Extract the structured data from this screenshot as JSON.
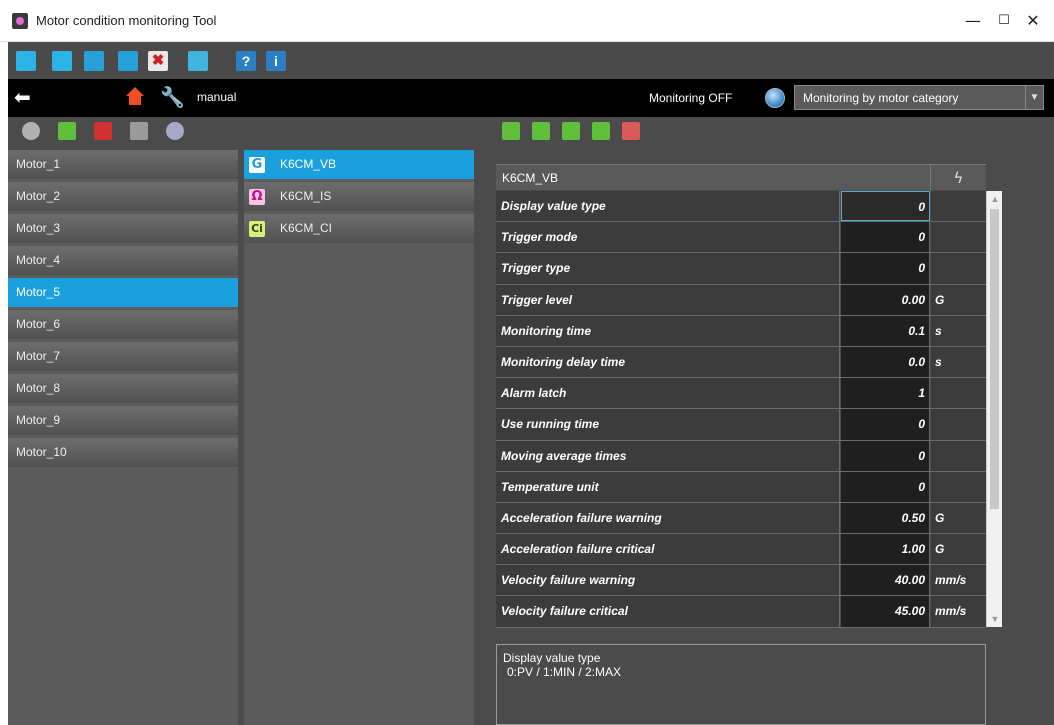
{
  "window": {
    "title": "Motor condition monitoring Tool",
    "minimize": "—",
    "maximize": "☐",
    "close": "✕"
  },
  "nav": {
    "mode_label": "manual",
    "monitoring_status": "Monitoring OFF",
    "monitoring_select": "Monitoring by motor category"
  },
  "motors": [
    {
      "label": "Motor_1"
    },
    {
      "label": "Motor_2"
    },
    {
      "label": "Motor_3"
    },
    {
      "label": "Motor_4"
    },
    {
      "label": "Motor_5",
      "selected": true
    },
    {
      "label": "Motor_6"
    },
    {
      "label": "Motor_7"
    },
    {
      "label": "Motor_8"
    },
    {
      "label": "Motor_9"
    },
    {
      "label": "Motor_10"
    }
  ],
  "sensors": [
    {
      "label": "K6CM_VB",
      "badge": "G",
      "badge_color": "#1aa0dd",
      "badge_bg": "#ffffff",
      "selected": true
    },
    {
      "label": "K6CM_IS",
      "badge": "Ω",
      "badge_color": "#c0128a",
      "badge_bg": "#f2c7e5"
    },
    {
      "label": "K6CM_CI",
      "badge": "Ci",
      "badge_color": "#2a4a10",
      "badge_bg": "#d7ef7a"
    }
  ],
  "param_table": {
    "header": "K6CM_VB",
    "header_icon": "lightning-icon",
    "rows": [
      {
        "label": "Display value type",
        "value": "0",
        "unit": ""
      },
      {
        "label": "Trigger mode",
        "value": "0",
        "unit": ""
      },
      {
        "label": "Trigger type",
        "value": "0",
        "unit": ""
      },
      {
        "label": "Trigger level",
        "value": "0.00",
        "unit": "G"
      },
      {
        "label": "Monitoring time",
        "value": "0.1",
        "unit": "s"
      },
      {
        "label": "Monitoring delay time",
        "value": "0.0",
        "unit": "s"
      },
      {
        "label": "Alarm latch",
        "value": "1",
        "unit": ""
      },
      {
        "label": "Use running time",
        "value": "0",
        "unit": ""
      },
      {
        "label": "Moving average times",
        "value": "0",
        "unit": ""
      },
      {
        "label": "Temperature unit",
        "value": "0",
        "unit": ""
      },
      {
        "label": "Acceleration failure warning",
        "value": "0.50",
        "unit": "G"
      },
      {
        "label": "Acceleration failure critical",
        "value": "1.00",
        "unit": "G"
      },
      {
        "label": "Velocity failure warning",
        "value": "40.00",
        "unit": "mm/s"
      },
      {
        "label": "Velocity failure critical",
        "value": "45.00",
        "unit": "mm/s"
      }
    ]
  },
  "description": {
    "title": "Display value type",
    "text": "0:PV / 1:MIN / 2:MAX"
  },
  "colors": {
    "accent": "#1aa0dd",
    "toolbar_bg": "#4a4a4a",
    "nav_bg": "#000000"
  }
}
